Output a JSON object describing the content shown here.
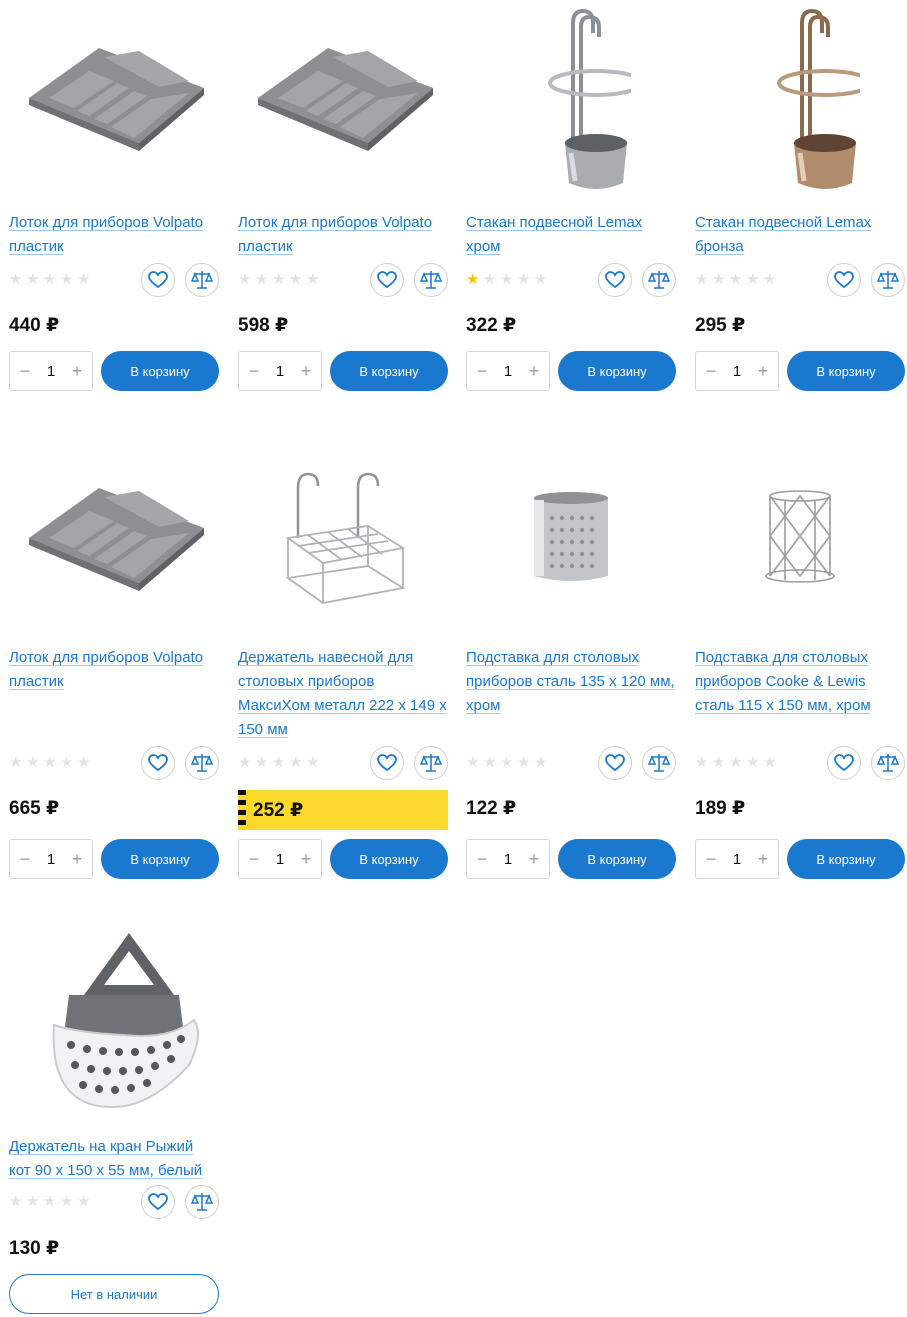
{
  "colors": {
    "accent": "#1a78cf",
    "promo": "#fbd92c",
    "star_on": "#f5c400",
    "star_off": "#e3e3e3"
  },
  "labels": {
    "add_to_cart": "В корзину",
    "out_of_stock": "Нет в наличии",
    "currency": "₽"
  },
  "products": [
    {
      "title": "Лоток для приборов Volpato пластик",
      "price": "440 ₽",
      "rating": 0,
      "qty": "1",
      "image": "grey-cutlery-tray"
    },
    {
      "title": "Лоток для приборов Volpato пластик",
      "price": "598 ₽",
      "rating": 0,
      "qty": "1",
      "image": "grey-cutlery-tray"
    },
    {
      "title": "Стакан подвесной Lemax хром",
      "price": "322 ₽",
      "rating": 1,
      "qty": "1",
      "image": "chrome-hanging-cup"
    },
    {
      "title": "Стакан подвесной Lemax бронза",
      "price": "295 ₽",
      "rating": 0,
      "qty": "1",
      "image": "bronze-hanging-cup"
    },
    {
      "title": "Лоток для приборов Volpato пластик",
      "price": "665 ₽",
      "rating": 0,
      "qty": "1",
      "image": "grey-cutlery-tray"
    },
    {
      "title": "Держатель навесной для столовых приборов МаксиХом металл 222 x 149 x 150 мм",
      "price": "252 ₽",
      "rating": 0,
      "qty": "1",
      "promo": true,
      "image": "wire-rack-holder"
    },
    {
      "title": "Подставка для столовых приборов сталь 135 x 120 мм, хром",
      "price": "122 ₽",
      "rating": 0,
      "qty": "1",
      "image": "perforated-steel-cup"
    },
    {
      "title": "Подставка для столовых приборов Cooke & Lewis сталь 115 x 150 мм, хром",
      "price": "189 ₽",
      "rating": 0,
      "qty": "1",
      "image": "wire-lattice-cup"
    },
    {
      "title": "Держатель на кран Рыжий кот 90 x 150 x 55 мм, белый",
      "price": "130 ₽",
      "rating": 0,
      "out_of_stock": true,
      "image": "faucet-sponge-holder"
    }
  ]
}
